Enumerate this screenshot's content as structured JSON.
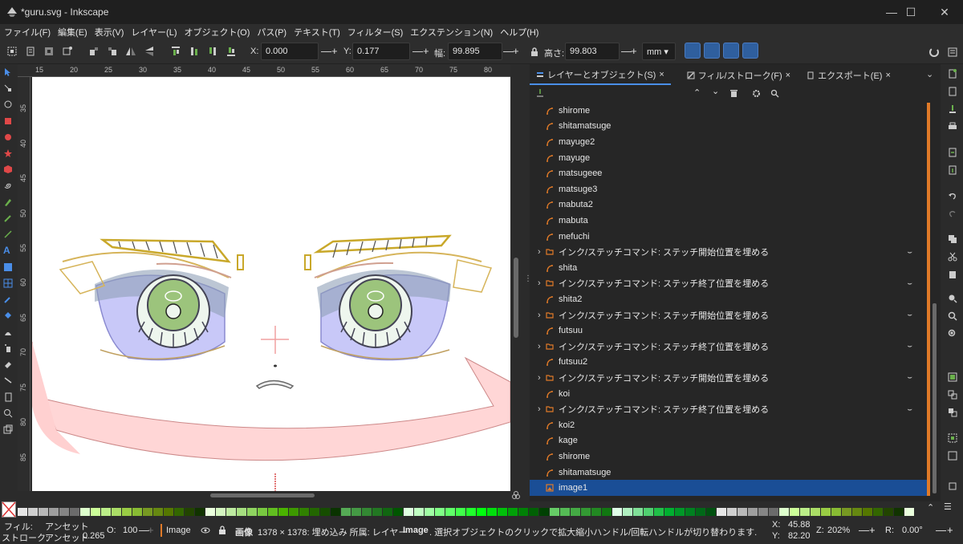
{
  "window": {
    "title": "*guru.svg - Inkscape",
    "minimize": "—",
    "maximize": "☐",
    "close": "✕"
  },
  "menu": [
    "ファイル(F)",
    "編集(E)",
    "表示(V)",
    "レイヤー(L)",
    "オブジェクト(O)",
    "パス(P)",
    "テキスト(T)",
    "フィルター(S)",
    "エクステンション(N)",
    "ヘルプ(H)"
  ],
  "toolbar": {
    "x_label": "X:",
    "x_value": "0.000",
    "y_label": "Y:",
    "y_value": "0.177",
    "w_label": "幅:",
    "w_value": "99.895",
    "h_label": "高さ:",
    "h_value": "99.803",
    "unit": "mm",
    "minus": "—",
    "plus": "+"
  },
  "ruler_h": [
    "15",
    "20",
    "25",
    "30",
    "35",
    "40",
    "45",
    "50",
    "55",
    "60",
    "65",
    "70",
    "75",
    "80"
  ],
  "ruler_v": [
    "35",
    "40",
    "45",
    "50",
    "55",
    "60",
    "65",
    "70",
    "75",
    "80",
    "85"
  ],
  "dock_tabs": [
    {
      "label": "レイヤーとオブジェクト(S)",
      "close": "×"
    },
    {
      "label": "フィル/ストローク(F)",
      "close": "×"
    },
    {
      "label": "エクスポート(E)",
      "close": "×"
    }
  ],
  "layers": [
    {
      "name": "shirome",
      "kind": "path"
    },
    {
      "name": "shitamatsuge",
      "kind": "path"
    },
    {
      "name": "mayuge2",
      "kind": "path"
    },
    {
      "name": "mayuge",
      "kind": "path"
    },
    {
      "name": "matsugeee",
      "kind": "path"
    },
    {
      "name": "matsuge3",
      "kind": "path"
    },
    {
      "name": "mabuta2",
      "kind": "path"
    },
    {
      "name": "mabuta",
      "kind": "path"
    },
    {
      "name": "mefuchi",
      "kind": "path"
    },
    {
      "name": "インク/ステッチコマンド: ステッチ開始位置を埋める",
      "kind": "group"
    },
    {
      "name": "shita",
      "kind": "path"
    },
    {
      "name": "インク/ステッチコマンド: ステッチ終了位置を埋める",
      "kind": "group"
    },
    {
      "name": "shita2",
      "kind": "path"
    },
    {
      "name": "インク/ステッチコマンド: ステッチ開始位置を埋める",
      "kind": "group"
    },
    {
      "name": "futsuu",
      "kind": "path"
    },
    {
      "name": "インク/ステッチコマンド: ステッチ終了位置を埋める",
      "kind": "group"
    },
    {
      "name": "futsuu2",
      "kind": "path"
    },
    {
      "name": "インク/ステッチコマンド: ステッチ開始位置を埋める",
      "kind": "group"
    },
    {
      "name": "koi",
      "kind": "path"
    },
    {
      "name": "インク/ステッチコマンド: ステッチ終了位置を埋める",
      "kind": "group"
    },
    {
      "name": "koi2",
      "kind": "path"
    },
    {
      "name": "kage",
      "kind": "path"
    },
    {
      "name": "shirome",
      "kind": "path"
    },
    {
      "name": "shitamatsuge",
      "kind": "path"
    },
    {
      "name": "image1",
      "kind": "image",
      "selected": true
    }
  ],
  "status": {
    "fill_label": "フィル:",
    "fill_value": "アンセット",
    "stroke_label": "ストローク:",
    "stroke_value": "アンセット",
    "stroke_width": "0.265",
    "opacity_label": "O:",
    "opacity_value": "100",
    "layer_name": "Image",
    "message_bold": "画像",
    "message": "1378 × 1378: 埋め込み 所属: レイヤー",
    "message_layer": "Image",
    "message_tail": ". 選択オブジェクトのクリックで拡大縮小ハンドル/回転ハンドルが切り替わります.",
    "x_label": "X:",
    "x_value": "45.88",
    "y_label": "Y:",
    "y_value": "82.20",
    "zoom_label": "Z:",
    "zoom_value": "202%",
    "rot_label": "R:",
    "rot_value": "0.00°"
  },
  "colors": {
    "accent": "#4a8ee8",
    "selection": "#1a4e96",
    "orange": "#e07a28"
  }
}
